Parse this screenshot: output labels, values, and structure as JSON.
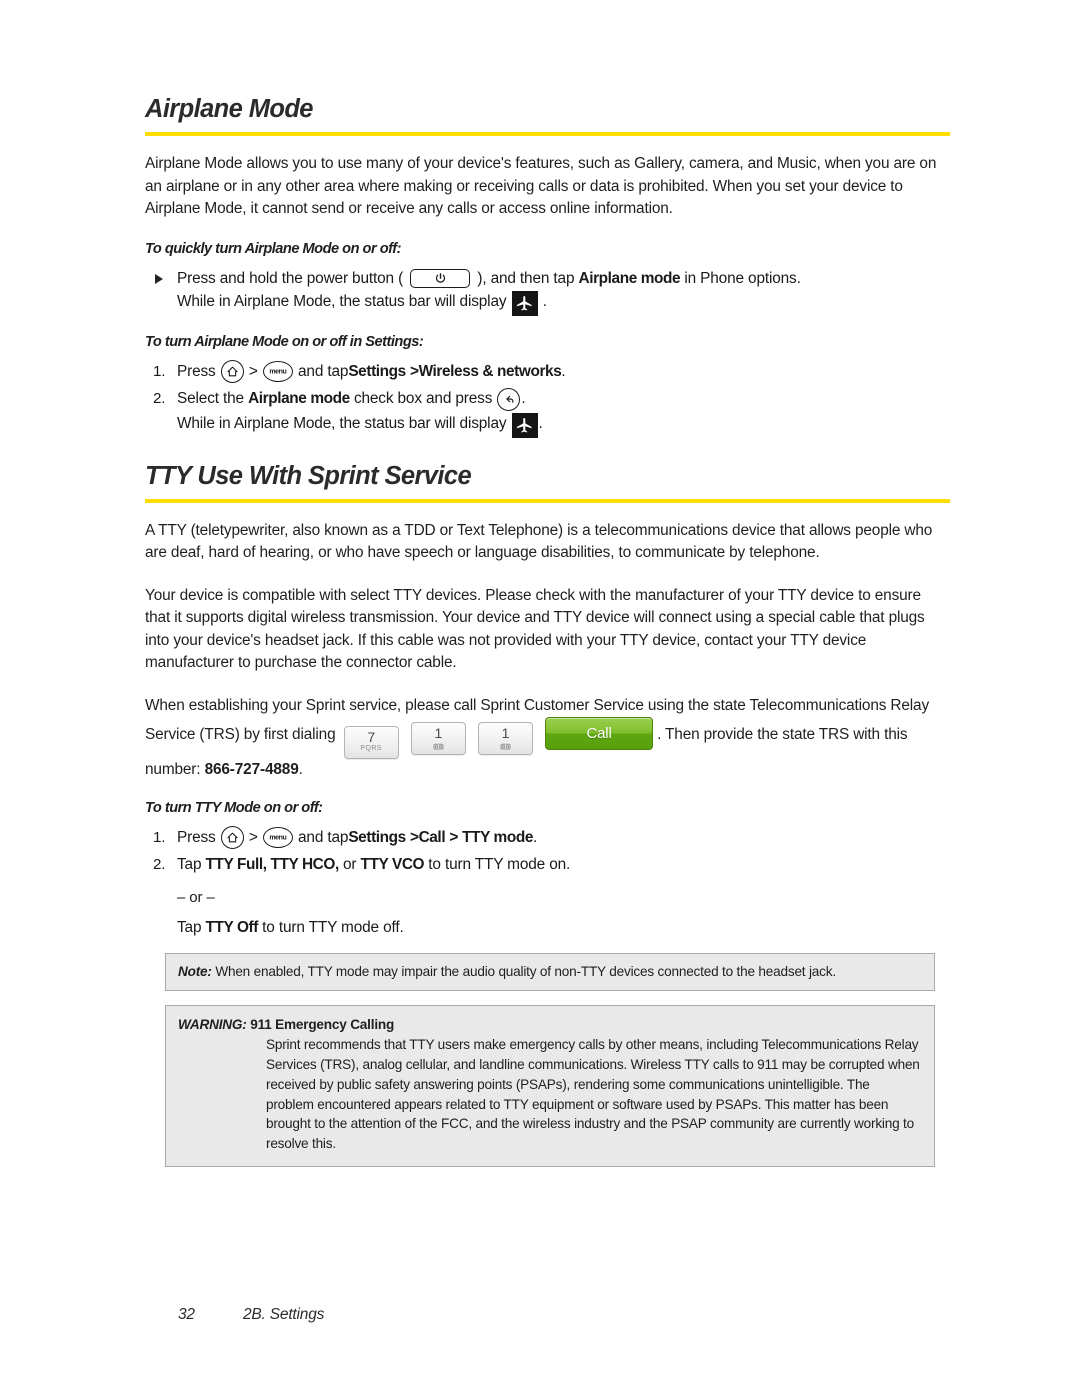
{
  "sections": [
    {
      "heading": "Airplane Mode",
      "intro": "Airplane Mode allows you to use many of your device's features, such as Gallery, camera, and Music, when you are on an airplane or in any other area where making or receiving calls or data is prohibited. When you set your device to Airplane Mode, it cannot send or receive any calls or access online information.",
      "sub1": "To quickly turn Airplane Mode on or off:",
      "bullet": {
        "t1": "Press and hold the power button (",
        "t2": "), and then tap",
        "bold1": "Airplane mode",
        "t3": "in Phone options.",
        "t4": "While in Airplane Mode, the status bar will display",
        "t5": "."
      },
      "sub2": "To turn Airplane Mode on or off in Settings:",
      "steps": [
        {
          "num": "1.",
          "t1": "Press",
          "sep": ">",
          "t2": "and tap",
          "bold1": "Settings",
          "sep2": ">",
          "bold2": "Wireless & networks",
          "t3": "."
        },
        {
          "num": "2.",
          "t1": "Select the",
          "bold1": "Airplane mode",
          "t2": "check box and press",
          "t3": ".",
          "line2a": "While in Airplane Mode, the status bar will display",
          "line2b": "."
        }
      ]
    }
  ],
  "tty": {
    "heading": "TTY Use With Sprint Service",
    "p1": "A TTY (teletypewriter, also known as a TDD or Text Telephone) is a telecommunications device that allows people who are deaf, hard of hearing, or who have speech or language disabilities, to communicate by telephone.",
    "p2": "Your device is compatible with select TTY devices. Please check with the manufacturer of your TTY device to ensure that it supports digital wireless transmission. Your device and TTY device will connect using a special cable that plugs into your device's headset jack. If this cable was not provided with your TTY device, contact your TTY device manufacturer to purchase the connector cable.",
    "p3_a": "When establishing your Sprint service, please call Sprint Customer Service using the state Telecommunications Relay Service (TRS) by first dialing",
    "p3_b": ". Then provide the state TRS with this number:",
    "trs_number": "866-727-4889",
    "p3_c": ".",
    "dial_keys": [
      {
        "digit": "7",
        "sub": "PQRS",
        "name": "dialpad-key-7"
      },
      {
        "digit": "1",
        "sub": "voicemail-icon",
        "name": "dialpad-key-1-first"
      },
      {
        "digit": "1",
        "sub": "voicemail-icon",
        "name": "dialpad-key-1-second"
      }
    ],
    "call_label": "Call",
    "sub3": "To turn TTY Mode on or off:",
    "steps": [
      {
        "num": "1.",
        "t1": "Press",
        "sep": ">",
        "t2": "and tap",
        "bold1": "Settings",
        "sep2": ">",
        "bold2": "Call",
        "sep3": ">",
        "bold3": "TTY mode",
        "t3": "."
      },
      {
        "num": "2.",
        "t1": "Tap",
        "bold1": "TTY Full, TTY HCO,",
        "t2": "or",
        "bold2": "TTY VCO",
        "t3": "to turn TTY mode on.",
        "or": "– or –",
        "line3a": "Tap",
        "bold3": "TTY Off",
        "line3b": "to turn TTY mode off."
      }
    ],
    "note": {
      "label": "Note:",
      "text": "When enabled, TTY mode may impair the audio quality of non-TTY devices connected to the headset jack."
    },
    "warning": {
      "label": "WARNING:",
      "title": "911 Emergency Calling",
      "body": "Sprint recommends that TTY users make emergency calls by other means, including Telecommunications Relay Services (TRS), analog cellular, and landline communications. Wireless TTY calls to 911 may be corrupted when received by public safety answering points (PSAPs), rendering some communications unintelligible. The problem encountered appears related to TTY equipment or software used by PSAPs. This matter has been brought to the attention of the FCC, and the wireless industry and the PSAP community are currently working to resolve this."
    }
  },
  "footer": {
    "page_number": "32",
    "chapter": "2B. Settings"
  },
  "colors": {
    "rule": "#ffdd00",
    "callout_bg": "#e9e9e9",
    "callout_border": "#a9a9a9",
    "call_button_green": "#6fb31e",
    "badge_black": "#151515"
  },
  "icons": {
    "home": "home-key-icon",
    "menu": "menu-key-icon",
    "menu_text": "menu",
    "back": "back-key-icon",
    "power": "power-button-icon",
    "airplane": "airplane-status-icon",
    "bullet": "triangle-bullet-icon"
  }
}
